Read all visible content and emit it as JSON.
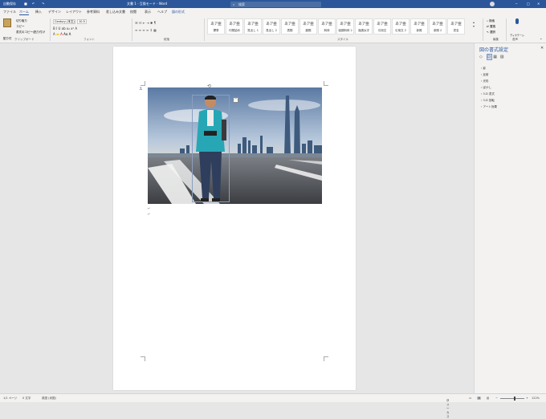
{
  "titlebar": {
    "autosave": "自動保存",
    "doc_title": "文書 1 - 互換モード - Word",
    "search_placeholder": "検索",
    "bg": "#2b579a"
  },
  "tabs": [
    "ファイル",
    "ホーム",
    "挿入",
    "デザイン",
    "レイアウト",
    "参考資料",
    "差し込み文書",
    "校閲",
    "表示",
    "ヘルプ",
    "図の形式"
  ],
  "ribbon": {
    "clipboard": {
      "paste": "貼り付け",
      "cut": "切り取り",
      "copy": "コピー",
      "format_painter": "書式のコピー/貼り付け",
      "label": "クリップボード"
    },
    "font": {
      "name": "Century (本文)",
      "size": "10.5",
      "label": "フォント"
    },
    "paragraph": {
      "label": "段落"
    },
    "styles": {
      "items": [
        {
          "sample": "あア亜",
          "name": "標準"
        },
        {
          "sample": "あア亜",
          "name": "行間詰め"
        },
        {
          "sample": "あア亜",
          "name": "見出し 1"
        },
        {
          "sample": "あア亜",
          "name": "見出し 2"
        },
        {
          "sample": "あア亜",
          "name": "表題"
        },
        {
          "sample": "あア亜",
          "name": "副題"
        },
        {
          "sample": "あア亜",
          "name": "斜体"
        },
        {
          "sample": "あア亜",
          "name": "強調斜体 2"
        },
        {
          "sample": "あア亜",
          "name": "強調太字"
        },
        {
          "sample": "あア亜",
          "name": "引用文"
        },
        {
          "sample": "あア亜",
          "name": "引用文 2"
        },
        {
          "sample": "あア亜",
          "name": "参照"
        },
        {
          "sample": "あア亜",
          "name": "参照 2"
        },
        {
          "sample": "あア亜",
          "name": "書名"
        }
      ],
      "label": "スタイル"
    },
    "editing": {
      "find": "検索",
      "replace": "置換",
      "select": "選択",
      "label": "編集"
    },
    "voice": {
      "dictate": "ディクテーション",
      "label": "音声"
    }
  },
  "pane": {
    "title": "図の書式設定",
    "sections": [
      "影",
      "反射",
      "光彩",
      "ぼかし",
      "3-D 書式",
      "3-D 回転",
      "アート効果"
    ]
  },
  "statusbar": {
    "page": "1/1 ページ",
    "words": "0 文字",
    "lang": "英語 (米国)",
    "focus": "フォーカス",
    "zoom": "122%"
  }
}
